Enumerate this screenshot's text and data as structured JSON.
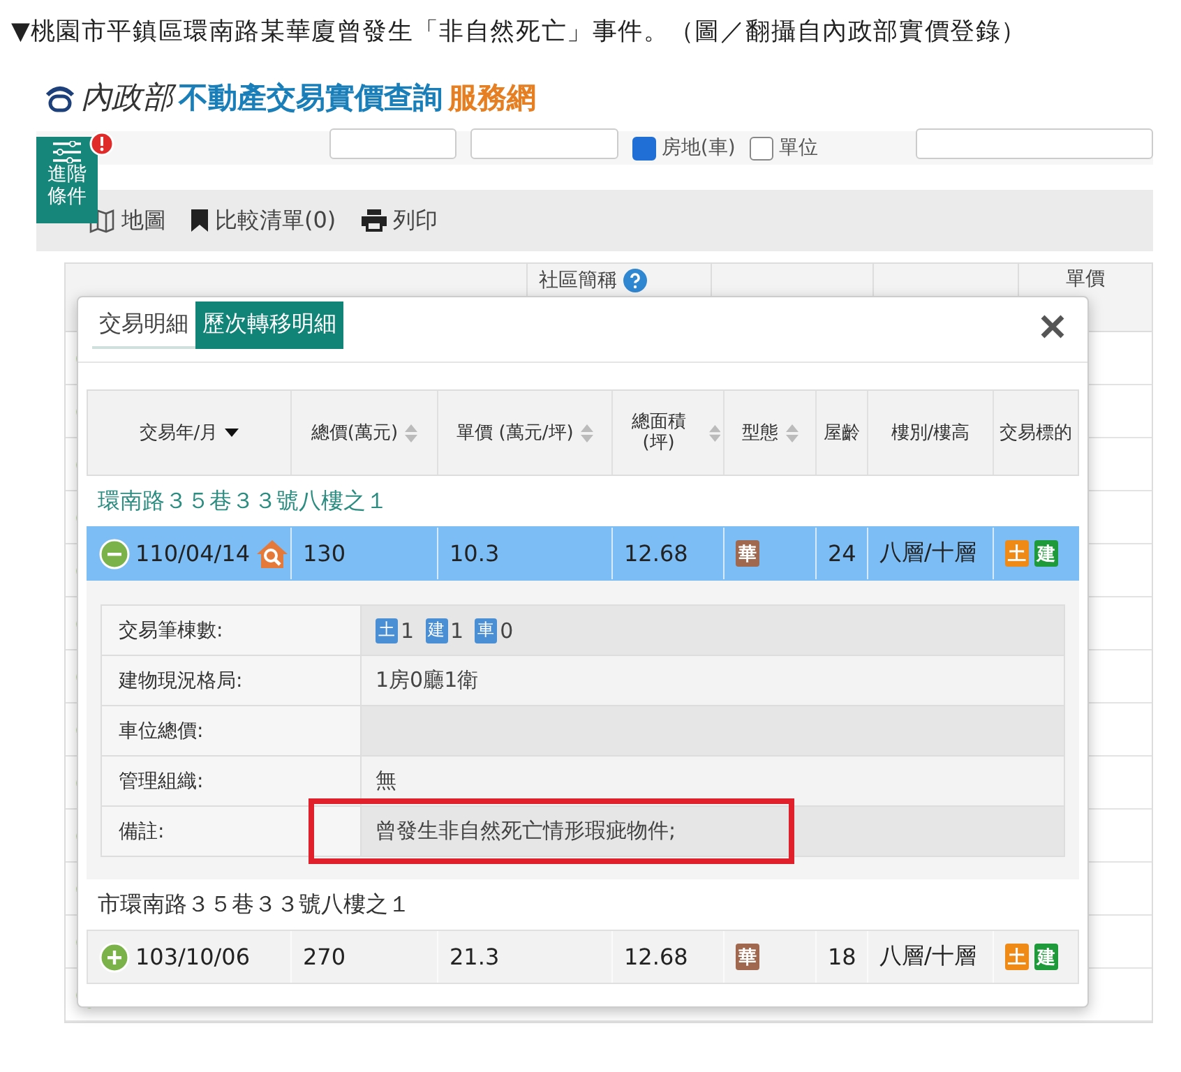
{
  "caption": "▼桃園市平鎮區環南路某華廈曾發生「非自然死亡」事件。（圖／翻攝自內政部實價登錄）",
  "site": {
    "ministry": "內政部",
    "title": "不動產交易實價查詢",
    "title_suffix": "服務網"
  },
  "filters": [
    {
      "label": "房地(車)",
      "checked": true
    },
    {
      "label": "單位",
      "checked": false
    }
  ],
  "advanced": {
    "label": "進階條件",
    "alert": true
  },
  "toolbar": [
    {
      "kind": "map",
      "label": "地圖"
    },
    {
      "kind": "bookmark",
      "label": "比較清單(0)"
    },
    {
      "kind": "print",
      "label": "列印"
    }
  ],
  "background_table": {
    "columns": [
      "社區簡稱",
      "單價"
    ]
  },
  "modal": {
    "tabs": [
      {
        "label": "交易明細",
        "selected": false
      },
      {
        "label": "歷次轉移明細",
        "selected": true
      }
    ],
    "columns": [
      {
        "label": "交易年/月",
        "sortable": true,
        "sorted": true
      },
      {
        "label": "總價(萬元)",
        "sortable": true,
        "sorted": false
      },
      {
        "label": "單價 (萬元/坪)",
        "sortable": true,
        "sorted": false
      },
      {
        "label": "總面積 (坪)",
        "sortable": true,
        "sorted": false
      },
      {
        "label": "型態",
        "sortable": true,
        "sorted": false
      },
      {
        "label": "屋齡",
        "sortable": false
      },
      {
        "label": "樓別/樓高",
        "sortable": false
      },
      {
        "label": "交易標的",
        "sortable": false
      }
    ],
    "groups": [
      {
        "address": "環南路３５巷３３號八樓之１",
        "color": "#2b8c80",
        "transactions": [
          {
            "date": "110/04/14",
            "total": "130",
            "unit": "10.3",
            "area": "12.68",
            "type": "華",
            "age": "24",
            "floor": "八層/十層",
            "expanded": true,
            "targets": [
              {
                "label": "土",
                "color": "#ef8a17"
              },
              {
                "label": "建",
                "color": "#1f9a3a"
              }
            ],
            "details": [
              {
                "kind": "counts",
                "label": "交易筆棟數:",
                "counts": [
                  {
                    "label": "土",
                    "value": "1"
                  },
                  {
                    "label": "建",
                    "value": "1"
                  },
                  {
                    "label": "車",
                    "value": "0"
                  }
                ]
              },
              {
                "kind": "text",
                "label": "建物現況格局:",
                "value": "1房0廳1衛"
              },
              {
                "kind": "text",
                "label": "車位總價:"
              },
              {
                "kind": "text",
                "label": "管理組織:",
                "value": "無"
              },
              {
                "kind": "text",
                "label": "備註:",
                "value": "曾發生非自然死亡情形瑕疵物件;",
                "highlighted": true
              }
            ]
          }
        ]
      },
      {
        "address": "市環南路３５巷３３號八樓之１",
        "color": "#333333",
        "transactions": [
          {
            "date": "103/10/06",
            "total": "270",
            "unit": "21.3",
            "area": "12.68",
            "type": "華",
            "age": "18",
            "floor": "八層/十層",
            "expanded": false,
            "targets": [
              {
                "label": "土",
                "color": "#ef8a17"
              },
              {
                "label": "建",
                "color": "#1f9a3a"
              }
            ]
          }
        ]
      }
    ]
  }
}
